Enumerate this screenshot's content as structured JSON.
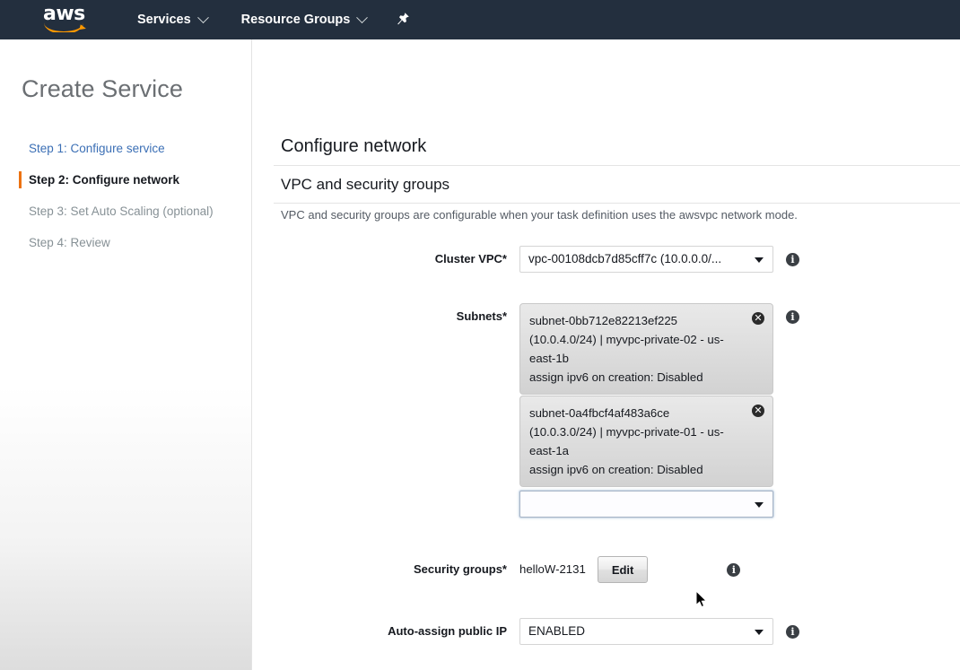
{
  "topnav": {
    "logo_text": "aws",
    "logo_name": "aws-logo",
    "services_label": "Services",
    "resource_groups_label": "Resource Groups",
    "pin_icon": "pushpin-icon",
    "background_color": "#232f3e",
    "accent_color": "#ff9900"
  },
  "page": {
    "title": "Create Service"
  },
  "sidebar": {
    "steps": [
      {
        "label": "Step 1: Configure service",
        "state": "link"
      },
      {
        "label": "Step 2: Configure network",
        "state": "active"
      },
      {
        "label": "Step 3: Set Auto Scaling (optional)",
        "state": "muted"
      },
      {
        "label": "Step 4: Review",
        "state": "muted"
      }
    ],
    "active_marker_color": "#ec7211",
    "link_color": "#3b6fb5"
  },
  "main": {
    "section_title": "Configure network",
    "subsection_title": "VPC and security groups",
    "description": "VPC and security groups are configurable when your task definition uses the awsvpc network mode.",
    "fields": {
      "cluster_vpc": {
        "label": "Cluster VPC*",
        "value": "vpc-00108dcb7d85cff7c (10.0.0.0/...",
        "info_glyph": "i"
      },
      "subnets": {
        "label": "Subnets*",
        "info_glyph": "i",
        "tokens": [
          {
            "id": "subnet-0bb712e82213ef225",
            "line1": "subnet-0bb712e82213ef225",
            "line2": "(10.0.4.0/24) | myvpc-private-02 - us-east-1b",
            "line3": "assign ipv6 on creation: Disabled",
            "remove_glyph": "✕"
          },
          {
            "id": "subnet-0a4fbcf4af483a6ce",
            "line1": "subnet-0a4fbcf4af483a6ce",
            "line2": "(10.0.3.0/24) | myvpc-private-01 - us-east-1a",
            "line3": "assign ipv6 on creation: Disabled",
            "remove_glyph": "✕"
          }
        ],
        "add_select_value": ""
      },
      "security_groups": {
        "label": "Security groups*",
        "value": "helloW-2131",
        "edit_label": "Edit",
        "info_glyph": "i"
      },
      "auto_assign_public_ip": {
        "label": "Auto-assign public IP",
        "value": "ENABLED",
        "info_glyph": "i"
      }
    }
  }
}
